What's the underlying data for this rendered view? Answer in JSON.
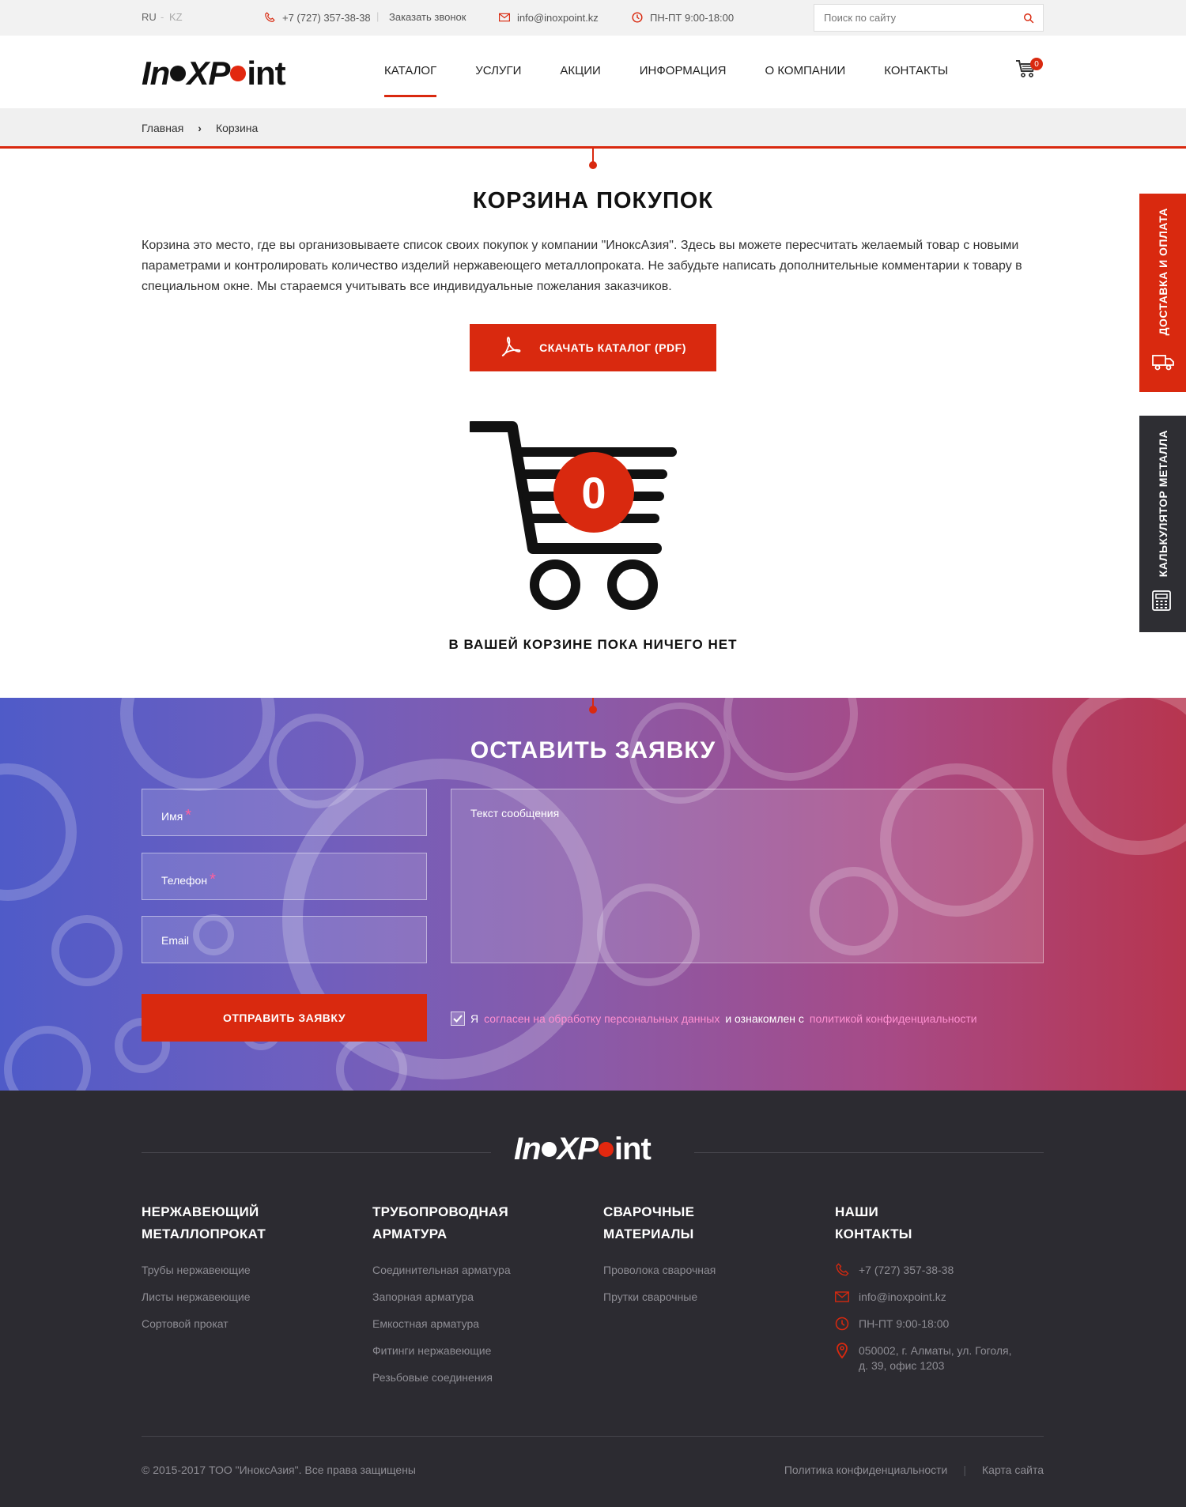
{
  "topbar": {
    "lang_ru": "RU",
    "lang_sep": "-",
    "lang_kz": "KZ",
    "phone": "+7 (727) 357-38-38",
    "callback": "Заказать звонок",
    "email": "info@inoxpoint.kz",
    "hours": "ПН-ПТ  9:00-18:00",
    "search_placeholder": "Поиск по сайту"
  },
  "logo": {
    "part1": "In",
    "part2": "XP",
    "part3": "int"
  },
  "nav": {
    "catalog": "КАТАЛОГ",
    "services": "УСЛУГИ",
    "promo": "АКЦИИ",
    "info": "ИНФОРМАЦИЯ",
    "about": "О КОМПАНИИ",
    "contacts": "КОНТАКТЫ",
    "cart_count": "0"
  },
  "breadcrumb": {
    "home": "Главная",
    "arrow": "›",
    "current": "Корзина"
  },
  "page": {
    "title": "КОРЗИНА ПОКУПОК",
    "intro": "Корзина это место, где вы организовываете список своих покупок у компании \"ИноксАзия\". Здесь вы можете пересчитать желаемый товар с новыми параметрами и контролировать количество изделий нержавеющего металлопроката. Не забудьте написать дополнительные комментарии к товару в специальном окне. Мы стараемся учитывать все индивидуальные пожелания заказчиков.",
    "download_label": "СКАЧАТЬ КАТАЛОГ (PDF)",
    "cart_count": "0",
    "empty_message": "В ВАШЕЙ КОРЗИНЕ ПОКА НИЧЕГО НЕТ"
  },
  "form": {
    "title": "ОСТАВИТЬ ЗАЯВКУ",
    "name": "Имя",
    "phone": "Телефон",
    "email": "Email",
    "required_mark": "*",
    "message": "Текст сообщения",
    "submit": "ОТПРАВИТЬ ЗАЯВКУ",
    "agree_1": "Я",
    "agree_link1": "согласен на обработку персональных данных",
    "agree_2": "и ознакомлен с",
    "agree_link2": "политикой конфиденциальности"
  },
  "side": {
    "delivery": "ДОСТАВКА И ОПЛАТА",
    "calculator": "КАЛЬКУЛЯТОР МЕТАЛЛА"
  },
  "footer": {
    "col1": {
      "title1": "НЕРЖАВЕЮЩИЙ",
      "title2": "МЕТАЛЛОПРОКАТ",
      "items": [
        "Трубы нержавеющие",
        "Листы нержавеющие",
        "Сортовой прокат"
      ]
    },
    "col2": {
      "title1": "ТРУБОПРОВОДНАЯ",
      "title2": "АРМАТУРА",
      "items": [
        "Соединительная арматура",
        "Запорная арматура",
        "Емкостная арматура",
        "Фитинги нержавеющие",
        "Резьбовые соединения"
      ]
    },
    "col3": {
      "title1": "СВАРОЧНЫЕ",
      "title2": "МАТЕРИАЛЫ",
      "items": [
        "Проволока сварочная",
        "Прутки сварочные"
      ]
    },
    "col4": {
      "title1": "НАШИ",
      "title2": "КОНТАКТЫ",
      "phone": "+7 (727) 357-38-38",
      "email": "info@inoxpoint.kz",
      "hours": "ПН-ПТ  9:00-18:00",
      "address1": "050002, г. Алматы, ул. Гоголя,",
      "address2": "д. 39, офис 1203"
    },
    "copyright": "© 2015-2017 ТОО \"ИноксАзия\". Все права защищены",
    "privacy": "Политика конфиденциальности",
    "link_sep": "|",
    "sitemap": "Карта сайта"
  },
  "colors": {
    "accent": "#d9290f",
    "footer_bg": "#2c2b31",
    "dark_tab": "#2e2e33"
  }
}
